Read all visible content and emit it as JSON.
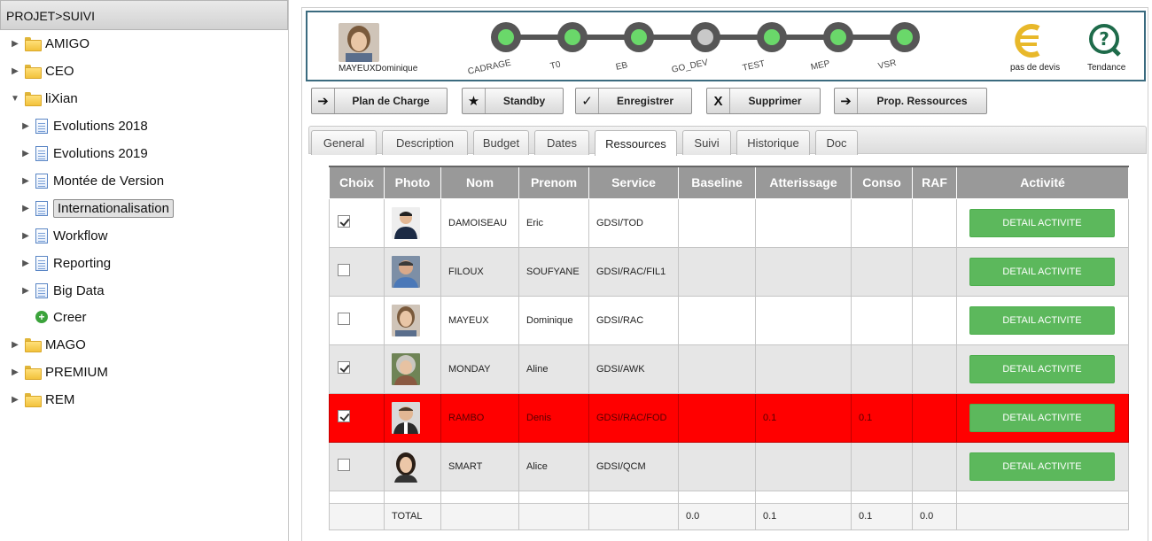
{
  "tree": {
    "header": "PROJET>SUIVI",
    "items": [
      {
        "label": "AMIGO",
        "type": "folder",
        "expanded": false
      },
      {
        "label": "CEO",
        "type": "folder",
        "expanded": false
      },
      {
        "label": "liXian",
        "type": "folder",
        "expanded": true
      },
      {
        "label": "Evolutions 2018",
        "type": "doc"
      },
      {
        "label": "Evolutions 2019",
        "type": "doc"
      },
      {
        "label": "Montée de Version",
        "type": "doc"
      },
      {
        "label": "Internationalisation",
        "type": "doc",
        "selected": true
      },
      {
        "label": "Workflow",
        "type": "doc"
      },
      {
        "label": "Reporting",
        "type": "doc"
      },
      {
        "label": "Big Data",
        "type": "doc"
      },
      {
        "label": "Creer",
        "type": "add"
      },
      {
        "label": "MAGO",
        "type": "folder",
        "expanded": false
      },
      {
        "label": "PREMIUM",
        "type": "folder",
        "expanded": false
      },
      {
        "label": "REM",
        "type": "folder",
        "expanded": false
      }
    ]
  },
  "workflow": {
    "owner_name": "MAYEUXDominique",
    "steps": [
      {
        "label": "CADRAGE",
        "status": "done"
      },
      {
        "label": "T0",
        "status": "done"
      },
      {
        "label": "EB",
        "status": "done"
      },
      {
        "label": "GO_DEV",
        "status": "pending"
      },
      {
        "label": "TEST",
        "status": "done"
      },
      {
        "label": "MEP",
        "status": "done"
      },
      {
        "label": "VSR",
        "status": "done"
      }
    ],
    "devis_label": "pas de devis",
    "tendance_label": "Tendance",
    "colors": {
      "done": "#6ad86a",
      "pending": "#c8c8c8",
      "line": "#555555"
    }
  },
  "toolbar": {
    "plan_label": "Plan de Charge",
    "standby_label": "Standby",
    "save_label": "Enregistrer",
    "delete_label": "Supprimer",
    "prop_label": "Prop. Ressources"
  },
  "tabs": [
    {
      "label": "General"
    },
    {
      "label": "Description"
    },
    {
      "label": "Budget"
    },
    {
      "label": "Dates"
    },
    {
      "label": "Ressources",
      "active": true
    },
    {
      "label": "Suivi"
    },
    {
      "label": "Historique"
    },
    {
      "label": "Doc"
    }
  ],
  "table": {
    "headers": [
      "Choix",
      "Photo",
      "Nom",
      "Prenom",
      "Service",
      "Baseline",
      "Atterissage",
      "Conso",
      "RAF",
      "Activité"
    ],
    "rows": [
      {
        "checked": true,
        "nom": "DAMOISEAU",
        "prenom": "Eric",
        "service": "GDSI/TOD",
        "baseline": "",
        "atterissage": "",
        "conso": "",
        "raf": "",
        "action": "DETAIL ACTIVITE",
        "alert": false
      },
      {
        "checked": false,
        "nom": "FILOUX",
        "prenom": "SOUFYANE",
        "service": "GDSI/RAC/FIL1",
        "baseline": "",
        "atterissage": "",
        "conso": "",
        "raf": "",
        "action": "DETAIL ACTIVITE",
        "alert": false
      },
      {
        "checked": false,
        "nom": "MAYEUX",
        "prenom": "Dominique",
        "service": "GDSI/RAC",
        "baseline": "",
        "atterissage": "",
        "conso": "",
        "raf": "",
        "action": "DETAIL ACTIVITE",
        "alert": false
      },
      {
        "checked": true,
        "nom": "MONDAY",
        "prenom": "Aline",
        "service": "GDSI/AWK",
        "baseline": "",
        "atterissage": "",
        "conso": "",
        "raf": "",
        "action": "DETAIL ACTIVITE",
        "alert": false
      },
      {
        "checked": true,
        "nom": "RAMBO",
        "prenom": "Denis",
        "service": "GDSI/RAC/FOD",
        "baseline": "",
        "atterissage": "0.1",
        "conso": "0.1",
        "raf": "",
        "action": "DETAIL ACTIVITE",
        "alert": true
      },
      {
        "checked": false,
        "nom": "SMART",
        "prenom": "Alice",
        "service": "GDSI/QCM",
        "baseline": "",
        "atterissage": "",
        "conso": "",
        "raf": "",
        "action": "DETAIL ACTIVITE",
        "alert": false
      }
    ],
    "total": {
      "label": "TOTAL",
      "baseline": "0.0",
      "atterissage": "0.1",
      "conso": "0.1",
      "raf": "0.0"
    },
    "colors": {
      "header_bg": "#999999",
      "alert_bg": "#ff0000",
      "button_bg": "#5cb85c"
    }
  }
}
